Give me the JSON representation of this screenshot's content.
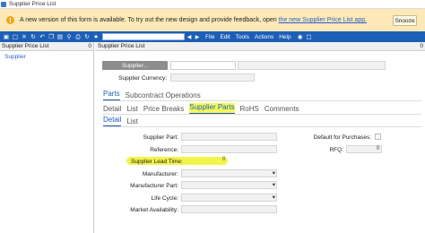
{
  "window": {
    "title": "Supplier Price List"
  },
  "banner": {
    "message": "A new version of this form is available. To try out the new design and provide feedback, open",
    "link": "the new Supplier Price List app.",
    "snooze_label": "Snooze"
  },
  "toolbar": {
    "icons": [
      "save-icon",
      "new-icon",
      "delete-icon",
      "refresh-icon",
      "undo-icon",
      "copy-icon",
      "paste-icon",
      "find-icon",
      "print-icon",
      "attach-icon",
      "favorite-icon"
    ],
    "combo_value": "",
    "menus": [
      "File",
      "Edit",
      "Tools",
      "Actions",
      "Help"
    ]
  },
  "nav_panel": {
    "title": "Supplier Price List",
    "pin": "0",
    "items": [
      "Supplier"
    ]
  },
  "main_panel": {
    "title": "Supplier Price List",
    "pin": "0"
  },
  "form": {
    "supplier_button": "Supplier...",
    "supplier_value": "",
    "supplier_name": "",
    "supplier_currency_label": "Supplier Currency:",
    "supplier_currency_value": ""
  },
  "tabs_level1": [
    "Parts",
    "Subcontract Operations"
  ],
  "tabs_level2": [
    "Detail",
    "List",
    "Price Breaks",
    "Supplier Parts",
    "RoHS",
    "Comments"
  ],
  "tabs_level3": [
    "Detail",
    "List"
  ],
  "fields": {
    "supplier_part": "Supplier Part:",
    "reference": "Reference:",
    "supplier_lead_time": "Supplier Lead Time:",
    "supplier_lead_time_value": "0",
    "manufacturer": "Manufacturer:",
    "manufacturer_part": "Manufacturer Part:",
    "life_cycle": "Life Cycle:",
    "market_availability": "Market Availability:",
    "default_for_purchases": "Default for Purchases:",
    "rfq": "RFQ:",
    "rfq_value": "0"
  }
}
